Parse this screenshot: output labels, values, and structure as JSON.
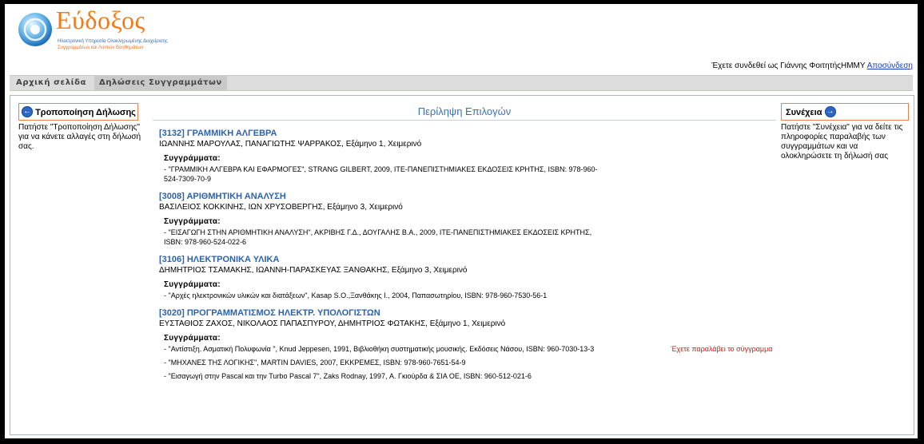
{
  "logo": {
    "wordmark": "Εύδοξος",
    "subtitle_line1": "Ηλεκτρονική Υπηρεσία Ολοκληρωμένης Διαχείρισης",
    "subtitle_line2": "Συγγραμμάτων και Λοιπών Βοηθημάτων"
  },
  "header": {
    "logged_in_text": "Έχετε συνδεθεί ως Γιάννης ΦοιτητήςΗΜΜΥ",
    "logout_label": "Αποσύνδεση"
  },
  "menu": {
    "home": "Αρχική σελίδα",
    "declarations": "Δηλώσεις Συγγραμμάτων"
  },
  "left": {
    "button_label": "Τροποποίηση Δήλωσης",
    "help": "Πατήστε \"Τροποποίηση Δήλωσης\" για να κάνετε αλλαγές στη δήλωσή σας."
  },
  "right": {
    "button_label": "Συνέχεια",
    "help": "Πατήστε \"Συνέχεια\" για να δείτε τις πληροφορίες παραλαβής των συγγραμμάτων και να ολοκληρώσετε τη δήλωσή σας"
  },
  "summary_title": "Περίληψη Επιλογών",
  "books_label": "Συγγράμματα:",
  "received_note": "Έχετε παραλάβει το σύγγραμμα",
  "courses": [
    {
      "title": "[3132] ΓΡΑΜΜΙΚΗ ΑΛΓΕΒΡΑ",
      "meta": "ΙΩΑΝΝΗΣ ΜΑΡΟΥΛΑΣ, ΠΑΝΑΓΙΩΤΗΣ ΨΑΡΡΑΚΟΣ, Εξάμηνο 1, Χειμερινό",
      "books": [
        "- \"ΓΡΑΜΜΙΚΗ ΑΛΓΕΒΡΑ ΚΑΙ ΕΦΑΡΜΟΓΕΣ\", STRANG GILBERT, 2009, ΙΤΕ-ΠΑΝΕΠΙΣΤΗΜΙΑΚΕΣ ΕΚΔΟΣΕΙΣ ΚΡΗΤΗΣ, ISBN: 978-960-524-7309-70-9"
      ]
    },
    {
      "title": "[3008] ΑΡΙΘΜΗΤΙΚΗ ΑΝΑΛΥΣΗ",
      "meta": "ΒΑΣΙΛΕΙΟΣ ΚΟΚΚΙΝΗΣ, ΙΩΝ ΧΡΥΣΟΒΕΡΓΗΣ, Εξάμηνο 3, Χειμερινό",
      "books": [
        "- \"ΕΙΣΑΓΩΓΗ ΣΤΗΝ ΑΡΙΘΜΗΤΙΚΗ ΑΝΑΛΥΣΗ\", ΑΚΡΙΒΗΣ Γ.Δ., ΔΟΥΓΑΛΗΣ Β.Α., 2009, ΙΤΕ-ΠΑΝΕΠΙΣΤΗΜΙΑΚΕΣ ΕΚΔΟΣΕΙΣ ΚΡΗΤΗΣ, ISBN: 978-960-524-022-6"
      ]
    },
    {
      "title": "[3106] ΗΛΕΚΤΡΟΝΙΚΑ ΥΛΙΚΑ",
      "meta": "ΔΗΜΗΤΡΙΟΣ ΤΣΑΜΑΚΗΣ, ΙΩΑΝΝΗ-ΠΑΡΑΣΚΕΥΑΣ ΞΑΝΘΑΚΗΣ, Εξάμηνο 3, Χειμερινό",
      "books": [
        "- \"Αρχές ηλεκτρονικών υλικών και διατάξεων\", Kasap S.O.,Ξανθάκης Ι., 2004, Παπασωτηρίου, ISBN: 978-960-7530-56-1"
      ]
    },
    {
      "title": "[3020] ΠΡΟΓΡΑΜΜΑΤΙΣΜΟΣ ΗΛΕΚΤΡ. ΥΠΟΛΟΓΙΣΤΩΝ",
      "meta": "ΕΥΣΤΑΘΙΟΣ ΖΑΧΟΣ, ΝΙΚΟΛΑΟΣ ΠΑΠΑΣΠΥΡΟΥ, ΔΗΜΗΤΡΙΟΣ ΦΩΤΑΚΗΣ, Εξάμηνο 1, Χειμερινό",
      "books": [
        "- \"Αντίστιξη. Ασματική Πολυφωνία \", Knud Jeppesen, 1991, Βιβλιοθήκη συστηματικής μουσικής. Εκδόσεις Νάσου, ISBN: 960-7030-13-3",
        "- \"ΜΗΧΑΝΕΣ ΤΗΣ ΛΟΓΙΚΗΣ\", MARTIN DAVIES, 2007, ΕΚΚΡΕΜΕΣ, ISBN: 978-960-7651-54-9",
        "- \"Εισαγωγή στην Pascal και την Turbo Pascal 7\", Zaks Rodnay, 1997, Α. Γκιούρδα & ΣΙΑ ΟΕ, ISBN: 960-512-021-6"
      ],
      "received_index": 0
    }
  ]
}
